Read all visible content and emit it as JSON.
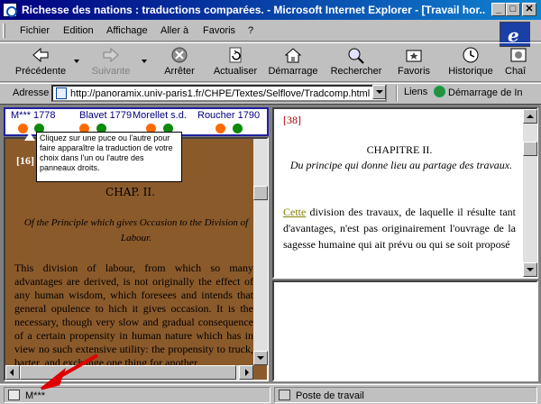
{
  "window": {
    "title": "Richesse des nations : traductions comparées. - Microsoft Internet Explorer - [Travail hor...",
    "controls": [
      "_",
      "□",
      "✕"
    ]
  },
  "menu": [
    "Fichier",
    "Edition",
    "Affichage",
    "Aller à",
    "Favoris",
    "?"
  ],
  "toolbar": {
    "back": "Précédente",
    "forward": "Suivante",
    "stop": "Arrêter",
    "refresh": "Actualiser",
    "home": "Démarrage",
    "search": "Rechercher",
    "favorites": "Favoris",
    "history": "Historique",
    "channels": "Chaî"
  },
  "address": {
    "label": "Adresse",
    "url": "http://panoramix.univ-paris1.fr/CHPE/Textes/Selflove/Tradcomp.html",
    "links_label": "Liens",
    "links_item": "Démarrage de In"
  },
  "translations": {
    "labels": [
      "M*** 1778",
      "Blavet 1779",
      "Morellet s.d.",
      "Roucher 1790"
    ],
    "tooltip": "Cliquez sur une puce ou l'autre pour faire apparaître la traduction de votre choix dans l'un ou l'autre des panneaux droits."
  },
  "left_pane": {
    "number": "[16]",
    "chapter": "CHAP. II.",
    "subtitle": "Of the Principle which gives Occasion to the Division of Labour.",
    "body": "This division of labour, from which so many advantages are derived, is not originally the effect of any human wisdom, which foresees and intends that general opulence to hich it gives occasion. It is the necessary, though very slow and gradual consequence of a certain propensity in human nature which has in view no such extensive utility: the propensity to truck, barter, and exchange one thing for another."
  },
  "right_pane": {
    "number": "[38]",
    "chapter": "CHAPITRE II.",
    "subtitle": "Du principe qui donne lieu au partage des travaux.",
    "first_word": "Cette",
    "body": " division des travaux, de laquelle il résulte tant d'avantages, n'est pas originairement l'ouvrage de la sagesse humaine qui ait prévu ou qui se soit proposé"
  },
  "status": {
    "left": "M***",
    "right": "Poste de travail"
  },
  "colors": {
    "title_bar": "#000080",
    "left_pane_bg": "#8b5a2b",
    "dot_orange": "#ff6a00",
    "dot_green": "#0a8a0a",
    "annotation_arrow": "#e00000",
    "right_number": "#a00000"
  }
}
